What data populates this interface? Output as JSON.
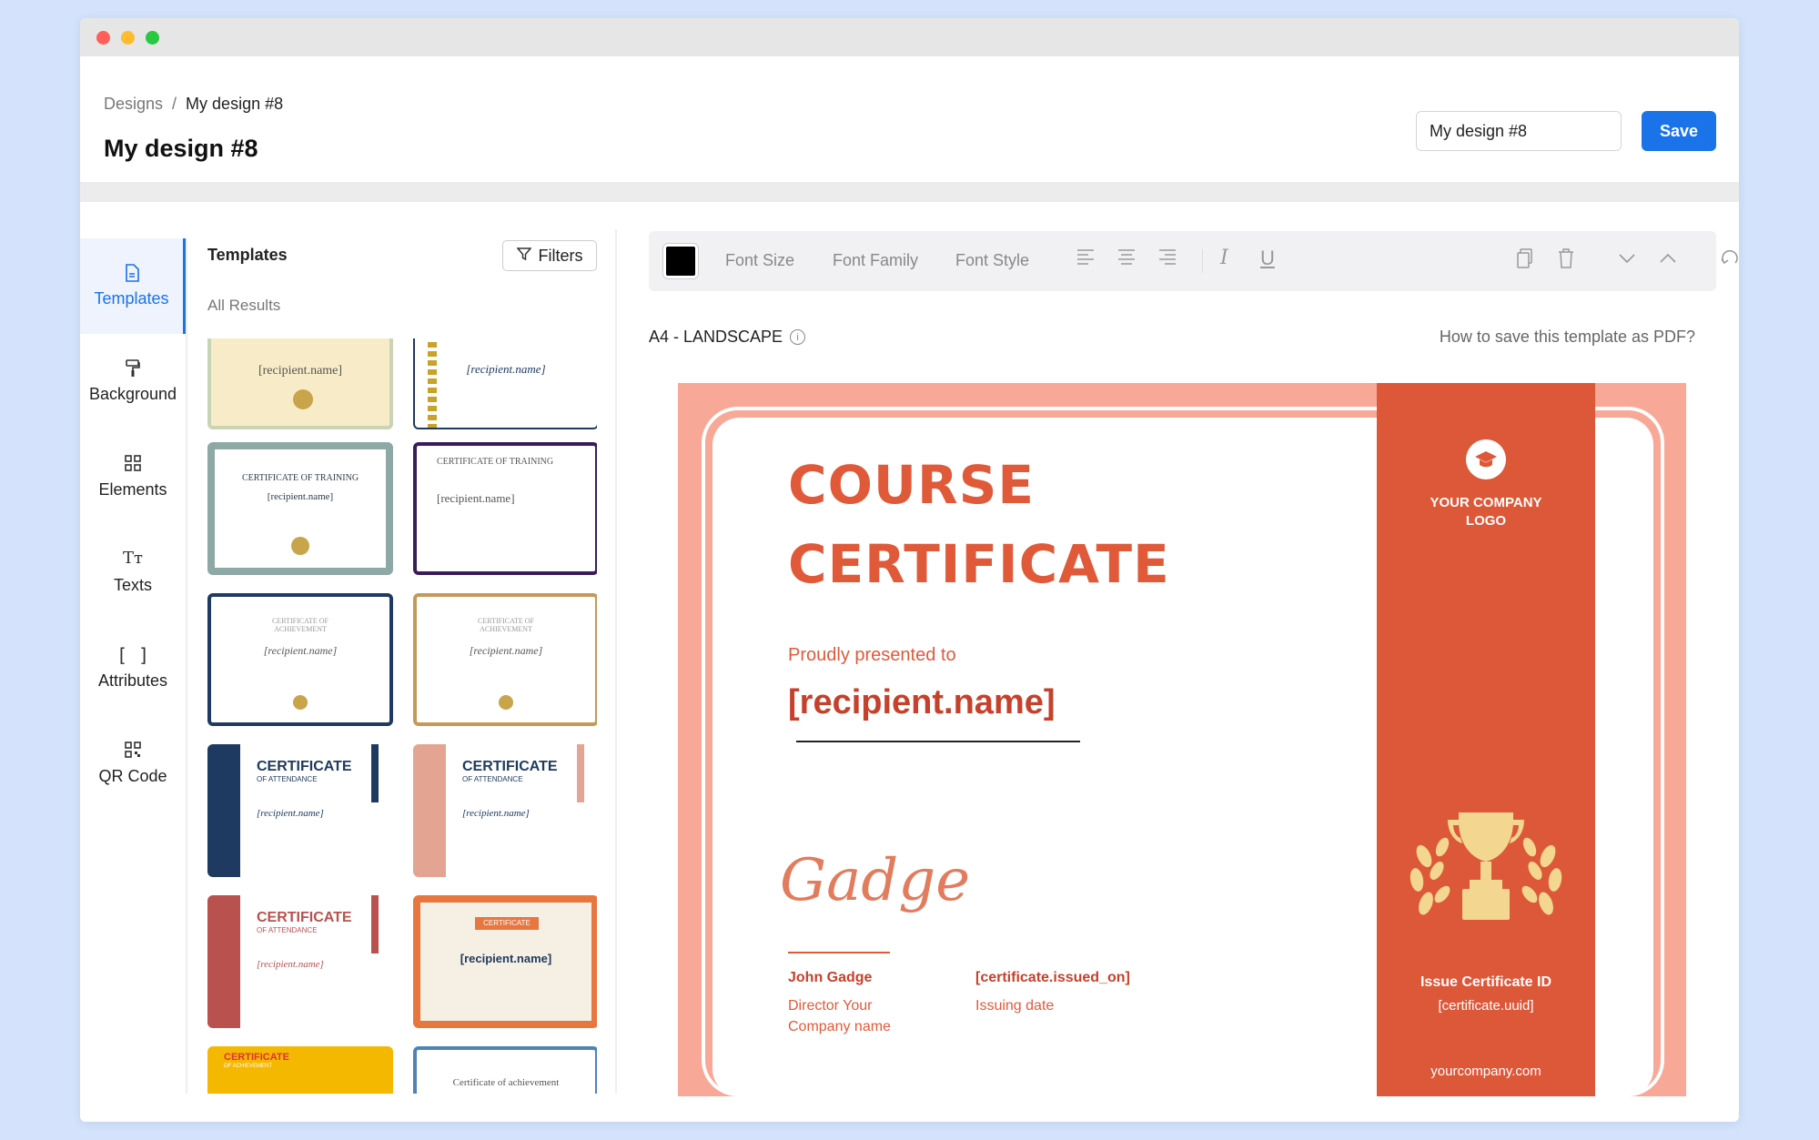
{
  "window": {
    "dots": [
      "#ff5f57",
      "#febc2e",
      "#28c840"
    ]
  },
  "breadcrumb": {
    "root": "Designs",
    "separator": "/",
    "current": "My design #8"
  },
  "page_title": "My design #8",
  "design_name_value": "My design #8",
  "save_label": "Save",
  "accent_color": "#1a73e8",
  "sidebar": {
    "items": [
      {
        "label": "Templates",
        "icon": "file-icon",
        "active": true
      },
      {
        "label": "Background",
        "icon": "paint-roller-icon",
        "active": false
      },
      {
        "label": "Elements",
        "icon": "grid-icon",
        "active": false
      },
      {
        "label": "Texts",
        "icon": "text-icon",
        "active": false
      },
      {
        "label": "Attributes",
        "icon": "brackets-icon",
        "active": false
      },
      {
        "label": "QR Code",
        "icon": "qr-code-icon",
        "active": false
      }
    ]
  },
  "templates_panel": {
    "title": "Templates",
    "filters_label": "Filters",
    "results_label": "All Results",
    "thumbs": [
      {
        "text": "[recipient.name]"
      },
      {
        "text": "[recipient.name]"
      },
      {
        "text": "CERTIFICATE OF TRAINING",
        "sub": "[recipient.name]"
      },
      {
        "text": "CERTIFICATE OF TRAINING",
        "sub": "[recipient.name]"
      },
      {
        "text": "CERTIFICATE OF ACHIEVEMENT",
        "sub": "[recipient.name]"
      },
      {
        "text": "CERTIFICATE OF ACHIEVEMENT",
        "sub": "[recipient.name]"
      },
      {
        "text": "CERTIFICATE",
        "sub": "OF ATTENDANCE",
        "extra": "[recipient.name]"
      },
      {
        "text": "CERTIFICATE",
        "sub": "OF ATTENDANCE",
        "extra": "[recipient.name]"
      },
      {
        "text": "CERTIFICATE",
        "sub": "OF ATTENDANCE",
        "extra": "[recipient.name]"
      },
      {
        "text": "CERTIFICATE",
        "extra": "[recipient.name]"
      },
      {
        "text": "CERTIFICATE",
        "sub": "OF ACHIEVEMENT"
      },
      {
        "text": "Certificate of achievement"
      }
    ]
  },
  "toolbar": {
    "font_size": "Font Size",
    "font_family": "Font Family",
    "font_style": "Font Style",
    "text_color": "#000000",
    "icons": [
      "align-left-icon",
      "align-center-icon",
      "align-right-icon",
      "italic-icon",
      "underline-icon",
      "copy-icon",
      "trash-icon",
      "move-down-icon",
      "move-up-icon",
      "undo-icon",
      "redo-icon"
    ]
  },
  "canvas": {
    "page_size": "A4 - LANDSCAPE",
    "help_link": "How to save this template as PDF?"
  },
  "certificate": {
    "title_line1": "COURSE",
    "title_line2": "CERTIFICATE",
    "presented": "Proudly presented to",
    "recipient": "[recipient.name]",
    "signature": "Gadge",
    "signer_name": "John Gadge",
    "signer_title_line1": "Director Your",
    "signer_title_line2": "Company name",
    "issued_on": "[certificate.issued_on]",
    "issued_label": "Issuing date",
    "logo_line1": "YOUR COMPANY",
    "logo_line2": "LOGO",
    "id_label": "Issue Certificate ID",
    "id_value": "[certificate.uuid]",
    "website": "yourcompany.com",
    "colors": {
      "border": "#f7a896",
      "band": "#dc5838",
      "title": "#e05a3a",
      "trophy": "#f3d68f"
    }
  }
}
